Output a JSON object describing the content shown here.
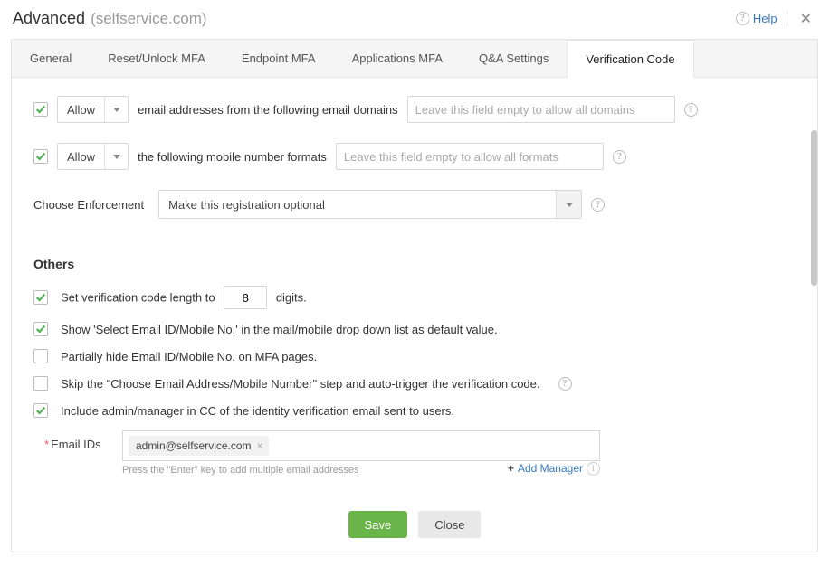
{
  "header": {
    "title": "Advanced",
    "subtitle": "(selfservice.com)",
    "help_label": "Help"
  },
  "tabs": [
    {
      "id": "general",
      "label": "General"
    },
    {
      "id": "reset",
      "label": "Reset/Unlock MFA"
    },
    {
      "id": "endpoint",
      "label": "Endpoint MFA"
    },
    {
      "id": "apps",
      "label": "Applications MFA"
    },
    {
      "id": "qa",
      "label": "Q&A Settings"
    },
    {
      "id": "vercode",
      "label": "Verification Code"
    }
  ],
  "email_domain_row": {
    "select_value": "Allow",
    "text": "email addresses from the following email domains",
    "placeholder": "Leave this field empty to allow all domains"
  },
  "mobile_row": {
    "select_value": "Allow",
    "text": "the following mobile number formats",
    "placeholder": "Leave this field empty to allow all formats"
  },
  "enforcement": {
    "label": "Choose Enforcement",
    "value": "Make this registration optional"
  },
  "others_heading": "Others",
  "opts": {
    "code_len_prefix": "Set verification code length to",
    "code_len_value": "8",
    "code_len_suffix": "digits.",
    "show_default": "Show 'Select Email ID/Mobile No.' in the mail/mobile drop down list as default value.",
    "partial_hide": "Partially hide Email ID/Mobile No. on MFA pages.",
    "skip_choose": "Skip the \"Choose Email Address/Mobile Number\" step and auto-trigger the verification code.",
    "include_cc": "Include admin/manager in CC of the identity verification email sent to users."
  },
  "email_ids": {
    "label": "Email IDs",
    "chip": "admin@selfservice.com",
    "hint": "Press the \"Enter\" key to add multiple email addresses",
    "add_manager_label": "Add Manager"
  },
  "footer": {
    "save": "Save",
    "close": "Close"
  }
}
